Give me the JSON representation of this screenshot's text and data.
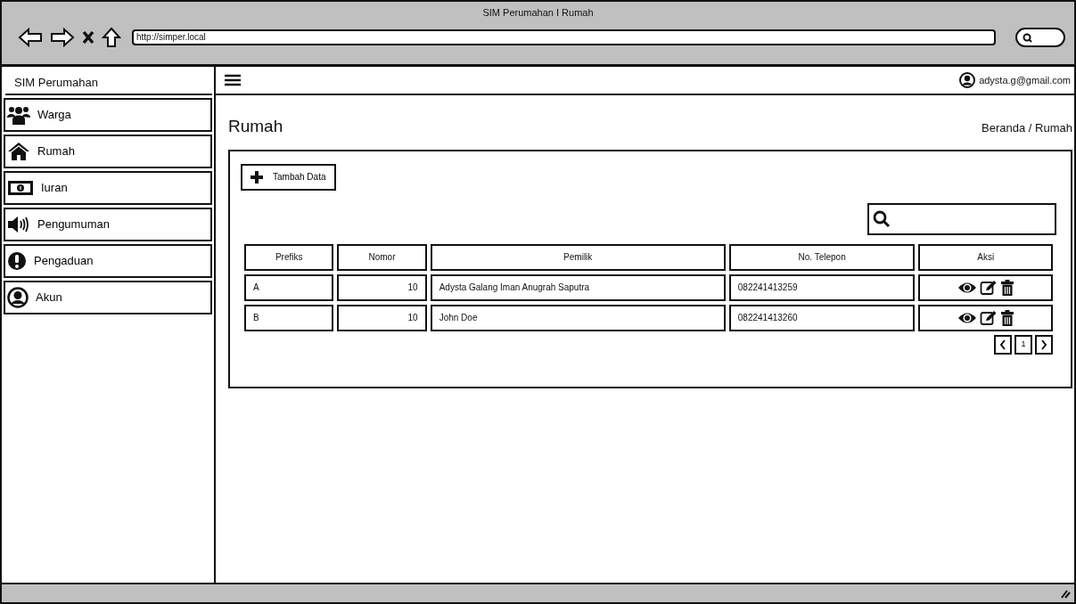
{
  "window": {
    "title": "SIM Perumahan I Rumah"
  },
  "browser": {
    "url": "http://simper.local"
  },
  "sidebar": {
    "brand": "SIM Perumahan",
    "items": [
      {
        "label": "Warga"
      },
      {
        "label": "Rumah"
      },
      {
        "label": "Iuran"
      },
      {
        "label": "Pengumuman"
      },
      {
        "label": "Pengaduan"
      },
      {
        "label": "Akun"
      }
    ]
  },
  "topbar": {
    "user_email": "adysta.g@gmail.com"
  },
  "page": {
    "title": "Rumah",
    "breadcrumb": "Beranda / Rumah"
  },
  "add_button": {
    "label": "Tambah Data"
  },
  "table": {
    "columns": [
      "Prefiks",
      "Nomor",
      "Pemilik",
      "No. Telepon",
      "Aksi"
    ],
    "rows": [
      {
        "cells": [
          "A",
          "10",
          "Adysta Galang Iman Anugrah Saputra",
          "082241413259"
        ]
      },
      {
        "cells": [
          "B",
          "10",
          "John Doe",
          "082241413260"
        ]
      }
    ]
  },
  "pagination": {
    "pages": [
      "1"
    ]
  }
}
